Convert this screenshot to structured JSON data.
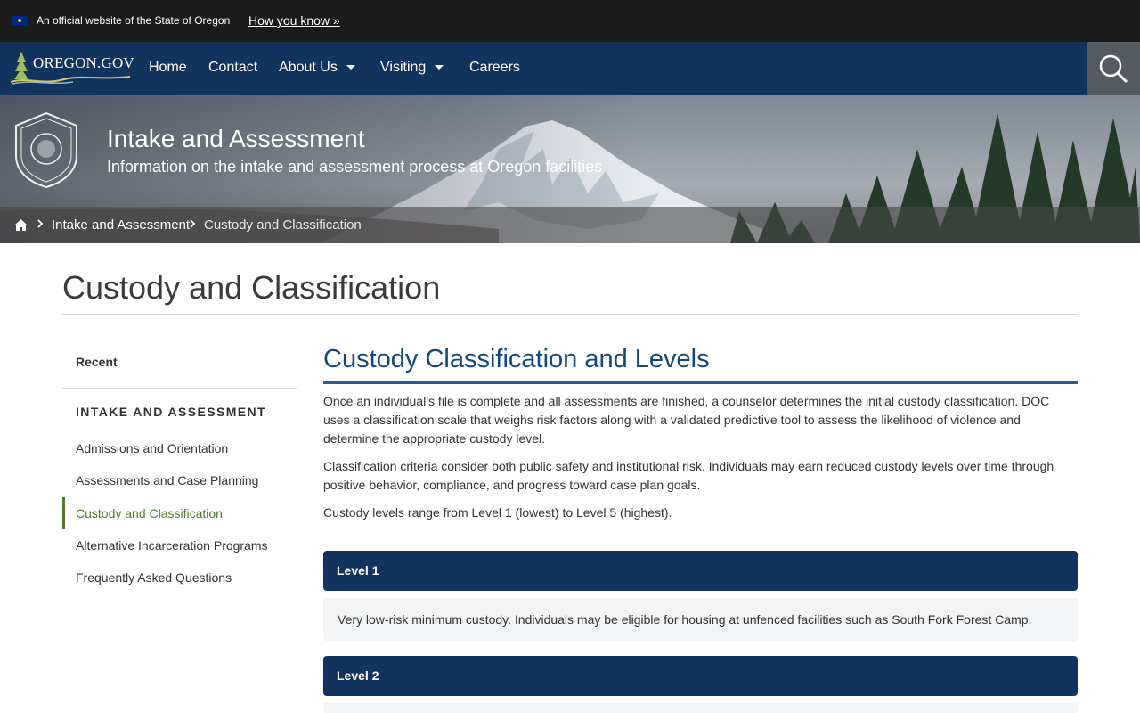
{
  "banner": {
    "official_text": "An official website of the State of Oregon",
    "how_you_know": "How you know »",
    "flag_icon": "oregon-flag-icon"
  },
  "nav": {
    "logo_text": "OREGON.GOV",
    "items": [
      {
        "label": "Home",
        "has_dropdown": false
      },
      {
        "label": "Contact",
        "has_dropdown": false
      },
      {
        "label": "About Us",
        "has_dropdown": true
      },
      {
        "label": "Visiting",
        "has_dropdown": true
      },
      {
        "label": "Careers",
        "has_dropdown": false
      }
    ],
    "search_icon": "search-icon"
  },
  "hero": {
    "title": "Intake and Assessment",
    "subtitle": "Information on the intake and assessment process at Oregon facilities",
    "seal_icon": "oregon-department-of-corrections-seal"
  },
  "breadcrumb": {
    "home_icon": "home-icon",
    "items": [
      "Intake and Assessment",
      "Custody and Classification"
    ]
  },
  "page": {
    "title": "Custody and Classification"
  },
  "sidebar": {
    "recent": "Recent",
    "heading": "INTAKE AND ASSESSMENT",
    "items": [
      {
        "label": "Admissions and Orientation",
        "active": false
      },
      {
        "label": "Assessments and Case Planning",
        "active": false
      },
      {
        "label": "Custody and Classification",
        "active": true
      },
      {
        "label": "Alternative Incarceration Programs",
        "active": false
      },
      {
        "label": "Frequently Asked Questions",
        "active": false
      }
    ],
    "accent_color": "#4b7b2a"
  },
  "content": {
    "title": "Custody Classification and Levels",
    "paragraphs": [
      "Once an individual’s file is complete and all assessments are finished, a counselor determines the initial custody classification. DOC uses a classification scale that weighs risk factors along with a validated predictive tool to assess the likelihood of violence and determine the appropriate custody level.",
      "Classification criteria consider both public safety and institutional risk. Individuals may earn reduced custody levels over time through positive behavior, compliance, and progress toward case plan goals.",
      "Custody levels range from Level 1 (lowest) to Level 5 (highest)."
    ],
    "levels": [
      {
        "label": "Level 1",
        "expanded": true,
        "body": "Very low-risk minimum custody. Individuals may be eligible for housing at unfenced facilities such as South Fork Forest Camp."
      },
      {
        "label": "Level 2",
        "expanded": false,
        "body": ""
      }
    ],
    "colors": {
      "nav": "#12335e",
      "title": "#12477e",
      "rule": "#1f5fa6"
    }
  }
}
